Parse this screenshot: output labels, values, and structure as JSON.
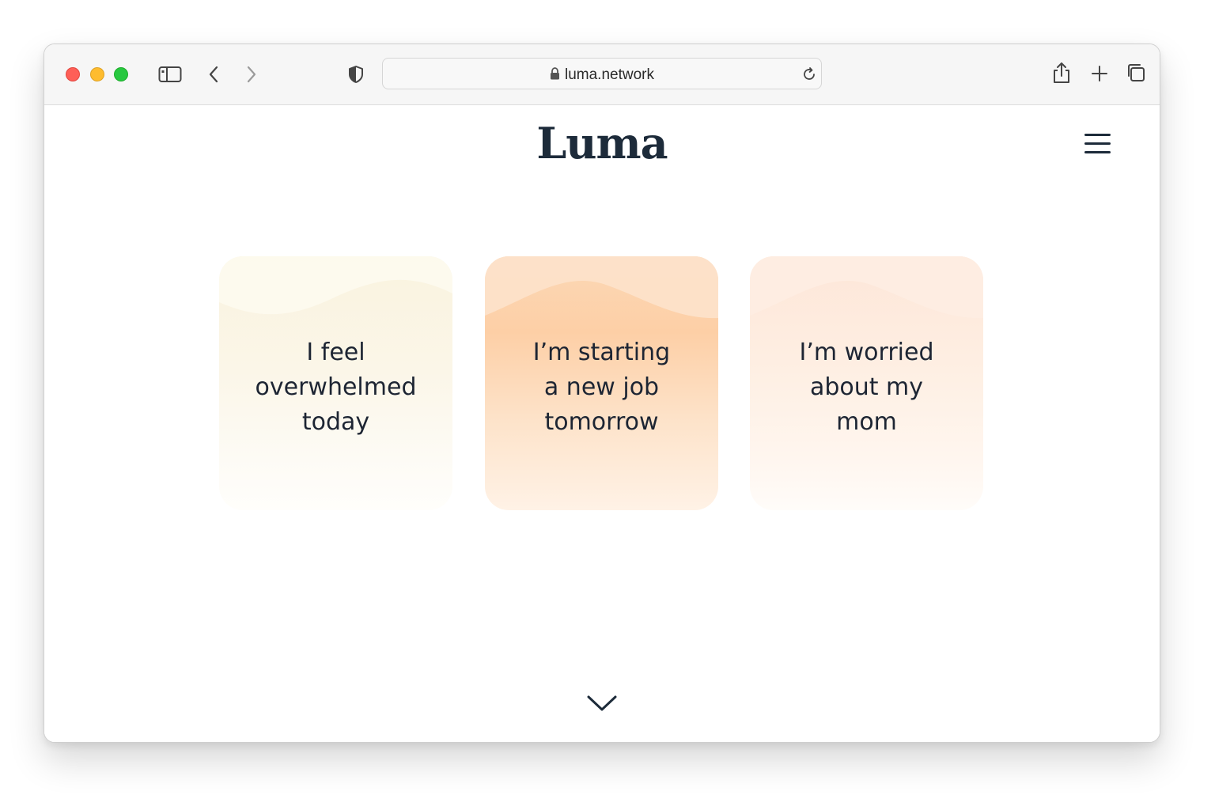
{
  "browser": {
    "url": "luma.network",
    "icons": {
      "sidebar": "sidebar-icon",
      "back": "chevron-left-icon",
      "forward": "chevron-right-icon",
      "privacy": "shield-icon",
      "lock": "lock-icon",
      "reload": "reload-icon",
      "share": "share-icon",
      "new_tab": "plus-icon",
      "tabs": "tabs-overview-icon"
    },
    "traffic_colors": {
      "close": "#fe5f57",
      "minimize": "#febc2e",
      "maximize": "#28c840"
    }
  },
  "site": {
    "logo": "Luma",
    "menu_icon": "hamburger-menu-icon",
    "prompts": [
      {
        "text": "I feel\noverwhelmed\ntoday"
      },
      {
        "text": "I’m starting\na new job\ntomorrow"
      },
      {
        "text": "I’m worried\nabout my\nmom"
      }
    ],
    "scroll_icon": "chevron-down-icon",
    "colors": {
      "text": "#1d2b3a",
      "card_yellow": "#faf3df",
      "card_orange": "#fdcfa6",
      "card_peach": "#fde6d8"
    }
  }
}
